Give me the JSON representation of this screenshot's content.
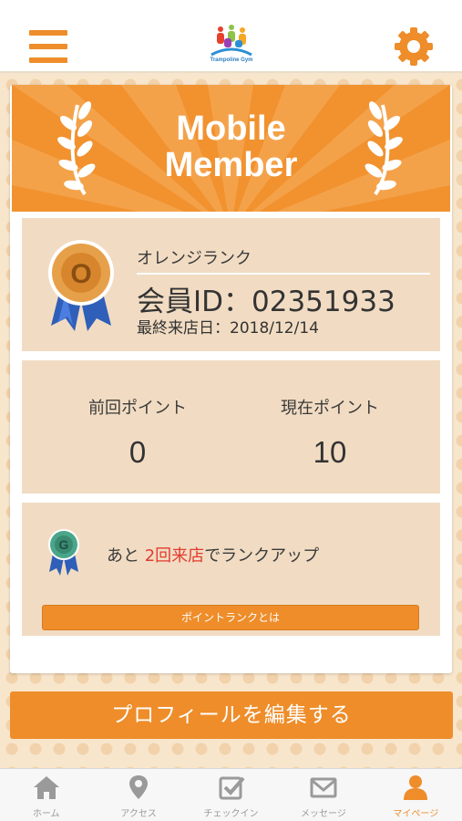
{
  "header": {
    "logo_text": "Trampoline Gym",
    "menu_icon": "hamburger-menu-icon",
    "settings_icon": "gear-icon"
  },
  "banner": {
    "title_line1": "Mobile",
    "title_line2": "Member"
  },
  "member": {
    "rank_name": "オレンジランク",
    "rank_badge_letter": "O",
    "member_id": "会員ID：02351933",
    "last_visit": "最終来店日：2018/12/14"
  },
  "points": {
    "previous_label": "前回ポイント",
    "previous_value": "0",
    "current_label": "現在ポイント",
    "current_value": "10"
  },
  "next_rank": {
    "badge_letter": "G",
    "text_before": "あと ",
    "highlight": "2回来店",
    "text_after": "でランクアップ",
    "button_label": "ポイントランクとは"
  },
  "edit_profile_label": "プロフィールを編集する",
  "tabs": [
    {
      "label": "ホーム",
      "icon": "home-icon",
      "active": false
    },
    {
      "label": "アクセス",
      "icon": "map-pin-icon",
      "active": false
    },
    {
      "label": "チェックイン",
      "icon": "checkin-icon",
      "active": false
    },
    {
      "label": "メッセージ",
      "icon": "envelope-icon",
      "active": false
    },
    {
      "label": "マイページ",
      "icon": "user-icon",
      "active": true
    }
  ],
  "colors": {
    "accent": "#ee8d2a",
    "panel": "#f1dcc3",
    "highlight": "#e23b2e",
    "tab_inactive": "#9a9a9a"
  }
}
